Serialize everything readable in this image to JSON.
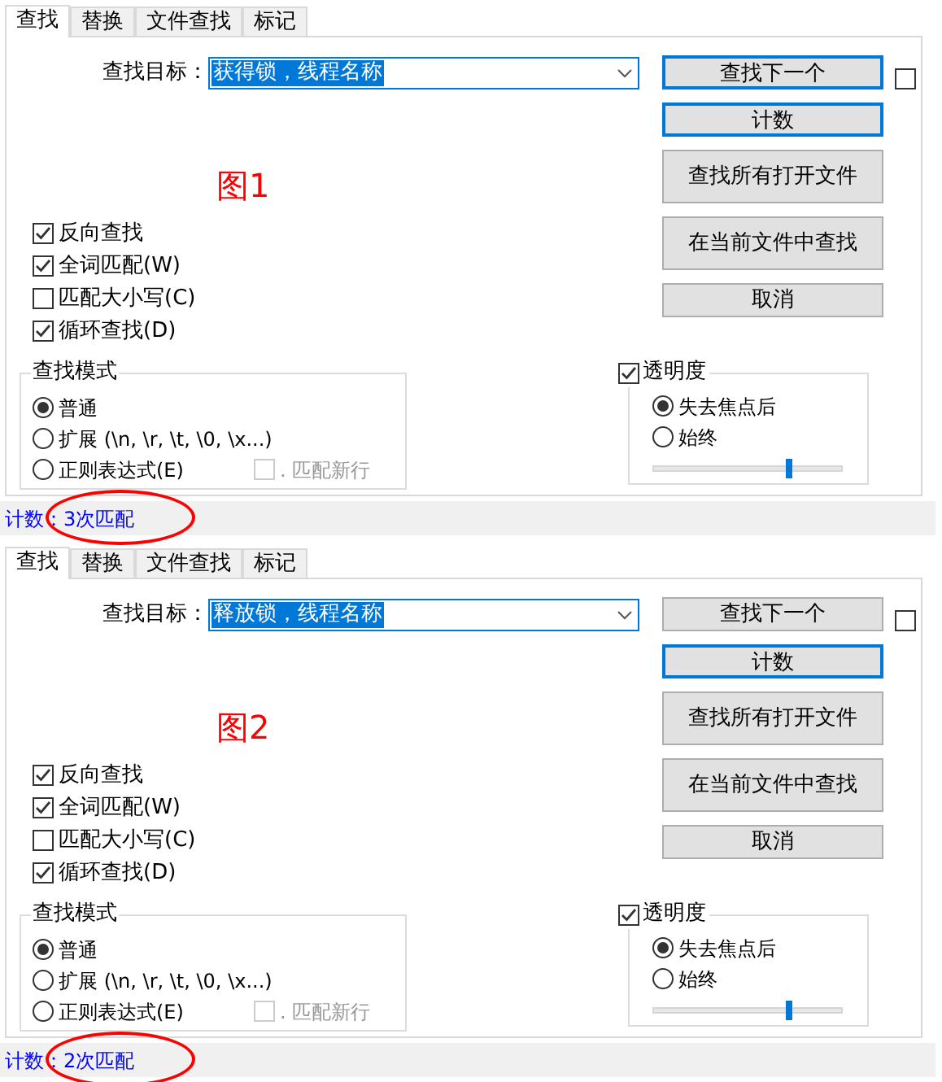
{
  "dialogs": [
    {
      "tabs": [
        {
          "label": "查找",
          "selected": true
        },
        {
          "label": "替换",
          "selected": false
        },
        {
          "label": "文件查找",
          "selected": false
        },
        {
          "label": "标记",
          "selected": false
        }
      ],
      "find_label": "查找目标：",
      "find_value": "获得锁，线程名称",
      "value_selected": true,
      "buttons": [
        {
          "label": "查找下一个",
          "focused": true,
          "kind": "small"
        },
        {
          "label": "计数",
          "focused": true,
          "kind": "small"
        },
        {
          "label": "查找所有打开文件",
          "focused": false,
          "kind": "tall"
        },
        {
          "label": "在当前文件中查找",
          "focused": false,
          "kind": "tall"
        },
        {
          "label": "取消",
          "focused": false,
          "kind": "small"
        }
      ],
      "side_checkbox": {
        "checked": false
      },
      "annotation_label": "图1",
      "options": [
        {
          "label": "反向查找",
          "checked": true
        },
        {
          "label": "全词匹配(W)",
          "checked": true
        },
        {
          "label": "匹配大小写(C)",
          "checked": false
        },
        {
          "label": "循环查找(D)",
          "checked": true
        }
      ],
      "search_mode": {
        "title": "查找模式",
        "modes": [
          {
            "label": "普通",
            "selected": true
          },
          {
            "label": "扩展 (\\n, \\r, \\t, \\0, \\x...)",
            "selected": false
          },
          {
            "label": "正则表达式(E)",
            "selected": false
          }
        ],
        "newline_option": {
          "label": ". 匹配新行",
          "checked": false,
          "disabled": true
        }
      },
      "transparency": {
        "label": "透明度",
        "checked": true,
        "modes": [
          {
            "label": "失去焦点后",
            "selected": true
          },
          {
            "label": "始终",
            "selected": false
          }
        ],
        "level": 0.72
      },
      "status": "计数：3次匹配",
      "status_circled": true
    },
    {
      "tabs": [
        {
          "label": "查找",
          "selected": true
        },
        {
          "label": "替换",
          "selected": false
        },
        {
          "label": "文件查找",
          "selected": false
        },
        {
          "label": "标记",
          "selected": false
        }
      ],
      "find_label": "查找目标：",
      "find_value": "释放锁，线程名称",
      "value_selected": true,
      "buttons": [
        {
          "label": "查找下一个",
          "focused": false,
          "kind": "small"
        },
        {
          "label": "计数",
          "focused": true,
          "kind": "small"
        },
        {
          "label": "查找所有打开文件",
          "focused": false,
          "kind": "tall"
        },
        {
          "label": "在当前文件中查找",
          "focused": false,
          "kind": "tall"
        },
        {
          "label": "取消",
          "focused": false,
          "kind": "small"
        }
      ],
      "side_checkbox": {
        "checked": false
      },
      "annotation_label": "图2",
      "options": [
        {
          "label": "反向查找",
          "checked": true
        },
        {
          "label": "全词匹配(W)",
          "checked": true
        },
        {
          "label": "匹配大小写(C)",
          "checked": false
        },
        {
          "label": "循环查找(D)",
          "checked": true
        }
      ],
      "search_mode": {
        "title": "查找模式",
        "modes": [
          {
            "label": "普通",
            "selected": true
          },
          {
            "label": "扩展 (\\n, \\r, \\t, \\0, \\x...)",
            "selected": false
          },
          {
            "label": "正则表达式(E)",
            "selected": false
          }
        ],
        "newline_option": {
          "label": ". 匹配新行",
          "checked": false,
          "disabled": true
        }
      },
      "transparency": {
        "label": "透明度",
        "checked": true,
        "modes": [
          {
            "label": "失去焦点后",
            "selected": true
          },
          {
            "label": "始终",
            "selected": false
          }
        ],
        "level": 0.72
      },
      "status": "计数：2次匹配",
      "status_circled": true
    }
  ]
}
